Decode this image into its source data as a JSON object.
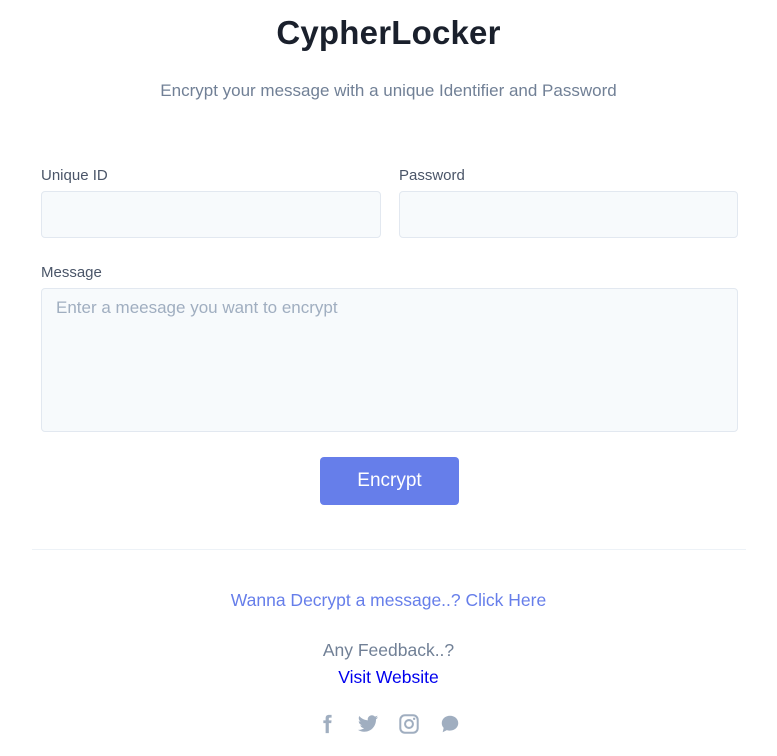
{
  "header": {
    "title": "CypherLocker",
    "subtitle": "Encrypt your message with a unique Identifier and Password"
  },
  "form": {
    "unique_id": {
      "label": "Unique ID",
      "value": "",
      "placeholder": ""
    },
    "password": {
      "label": "Password",
      "value": "",
      "placeholder": ""
    },
    "message": {
      "label": "Message",
      "value": "",
      "placeholder": "Enter a meesage you want to encrypt"
    },
    "submit_label": "Encrypt"
  },
  "footer": {
    "decrypt_link": "Wanna Decrypt a message..? Click Here",
    "feedback_text": "Any Feedback..?",
    "visit_link": "Visit Website",
    "social_icons": [
      "facebook-icon",
      "twitter-icon",
      "instagram-icon",
      "chat-icon"
    ]
  },
  "colors": {
    "accent": "#667eea",
    "title": "#1a202c",
    "muted_text": "#718096",
    "field_bg": "#f7fafc",
    "field_border": "#e2e8f0",
    "link": "#0000ee",
    "icon": "#a0aec0"
  }
}
